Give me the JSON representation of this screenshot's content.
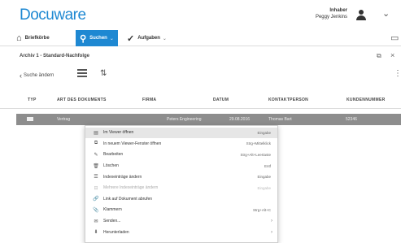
{
  "app": {
    "logo": "Docuware"
  },
  "user": {
    "role": "Inhaber",
    "name": "Peggy Jenkins"
  },
  "nav": {
    "briefkoerbe": "Briefkörbe",
    "suchen": "Suchen",
    "aufgaben": "Aufgaben"
  },
  "panel": {
    "title": "Archiv 1 - Standard-Nachfolge"
  },
  "toolbar": {
    "back_label": "Suche ändern"
  },
  "table": {
    "headers": [
      "TYP",
      "ART DES DOKUMENTS",
      "FIRMA",
      "DATUM",
      "KONTAKTPERSON",
      "KUNDENNUMMER"
    ],
    "selected_row": {
      "art": "Vertrag",
      "firma": "Peters Engineering",
      "datum": "29.08.2016",
      "kontakt": "Thomas Bart",
      "kundennummer": "52346"
    }
  },
  "context_menu": {
    "items": [
      {
        "icon": "viewer-icon",
        "glyph": "▤",
        "label": "Im Viewer öffnen",
        "shortcut": "Eingabe",
        "active": true,
        "disabled": false
      },
      {
        "icon": "new-window-icon",
        "glyph": "⧉",
        "label": "In neuem Viewer-Fenster öffnen",
        "shortcut": "Strg+Mittelklick",
        "active": false,
        "disabled": false
      },
      {
        "icon": "pencil-icon",
        "glyph": "✎",
        "label": "Bearbeiten",
        "shortcut": "Strg+Alt+Leertaste",
        "active": false,
        "disabled": false
      },
      {
        "icon": "trash-icon",
        "glyph": "🗑",
        "label": "Löschen",
        "shortcut": "Entf",
        "active": false,
        "disabled": false
      },
      {
        "icon": "index-edit-icon",
        "glyph": "☰",
        "label": "Indexeinträge ändern",
        "shortcut": "Eingabe",
        "active": false,
        "disabled": false
      },
      {
        "icon": "stamp-icon",
        "glyph": "⊟",
        "label": "Mehrere Indexeinträge ändern",
        "shortcut": "Eingabe",
        "active": false,
        "disabled": true
      },
      {
        "icon": "link-icon",
        "glyph": "🔗",
        "label": "Link auf Dokument abrufen",
        "shortcut": "",
        "active": false,
        "disabled": false
      },
      {
        "icon": "paperclip-icon",
        "glyph": "📎",
        "label": "Klammern",
        "shortcut": "Strg+Alt+C",
        "active": false,
        "disabled": false
      },
      {
        "icon": "send-icon",
        "glyph": "✉",
        "label": "Senden...",
        "shortcut": "",
        "submenu": true,
        "active": false,
        "disabled": false
      },
      {
        "icon": "download-icon",
        "glyph": "⬇",
        "label": "Herunterladen",
        "shortcut": "",
        "submenu": true,
        "active": false,
        "disabled": false
      }
    ]
  },
  "colors": {
    "accent": "#1e88d2",
    "selected_row": "#8d8d8d"
  }
}
